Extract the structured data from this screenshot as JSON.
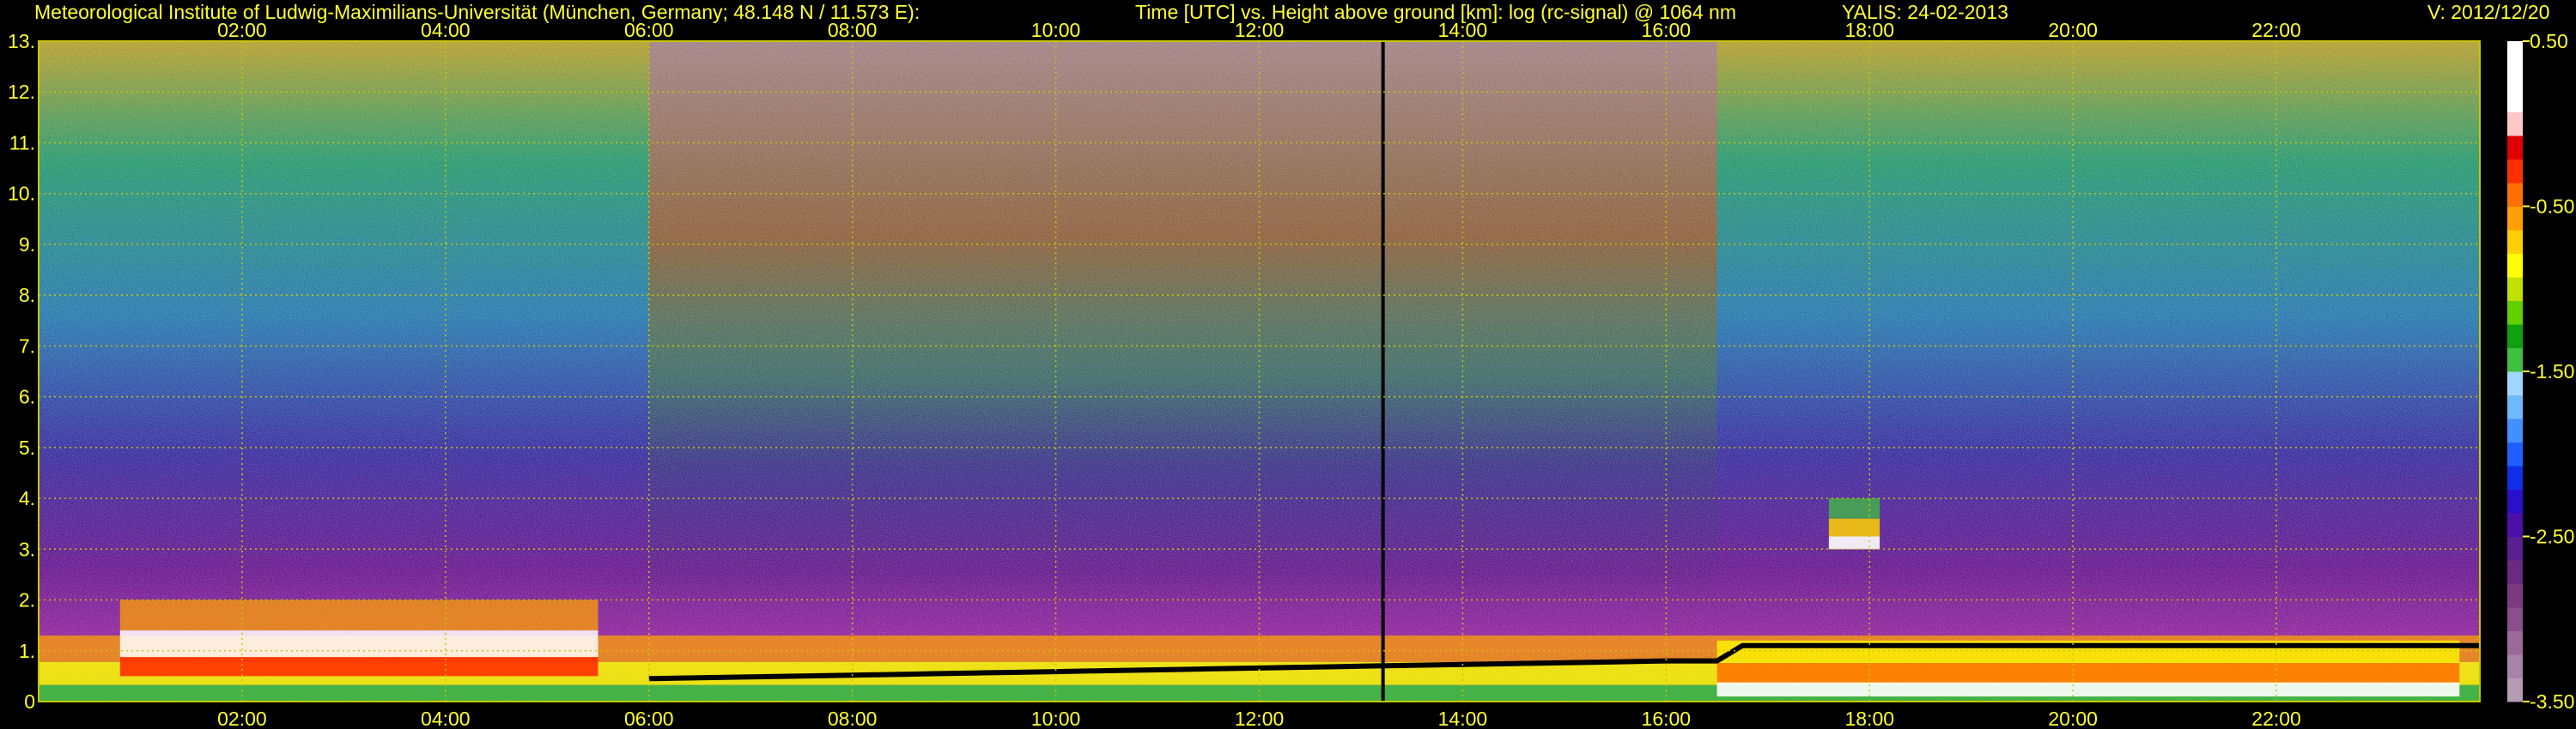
{
  "header": {
    "institute": "Meteorological Institute of Ludwig-Maximilians-Universität (München, Germany; 48.148 N / 11.573 E):",
    "description": "Time [UTC] vs. Height above ground [km]: log (rc-signal) @ 1064 nm",
    "instrument_date": "YALIS: 24-02-2013",
    "version": "V: 2012/12/20"
  },
  "chart_data": {
    "type": "heatmap",
    "title": "Time [UTC] vs. Height above ground [km]: log (rc-signal) @ 1064 nm",
    "x_unit": "hours UTC",
    "xlim": [
      0,
      24
    ],
    "x_ticks": [
      2,
      4,
      6,
      8,
      10,
      12,
      14,
      16,
      18,
      20,
      22
    ],
    "x_tick_labels": [
      "02:00",
      "04:00",
      "06:00",
      "08:00",
      "10:00",
      "12:00",
      "14:00",
      "16:00",
      "18:00",
      "20:00",
      "22:00"
    ],
    "y_unit": "km",
    "ylim": [
      0,
      13
    ],
    "y_ticks": [
      0,
      1,
      2,
      3,
      4,
      5,
      6,
      7,
      8,
      9,
      10,
      11,
      12,
      13
    ],
    "y_tick_labels": [
      "0",
      "1.",
      "2.",
      "3.",
      "4.",
      "5.",
      "6.",
      "7.",
      "8.",
      "9.",
      "10.",
      "11.",
      "12.",
      "13."
    ],
    "grid": true,
    "colorbar": {
      "range": [
        -3.5,
        0.5
      ],
      "ticks": [
        0.5,
        -0.5,
        -1.5,
        -2.5,
        -3.5
      ],
      "tick_labels": [
        "0.50",
        "-0.50",
        "-1.50",
        "-2.50",
        "-3.50"
      ],
      "colors": [
        "#b59cb5",
        "#a883a8",
        "#9a6a9a",
        "#8a4f8a",
        "#7a3a80",
        "#6a2a80",
        "#5a1f90",
        "#4a10a8",
        "#2a10c8",
        "#1030e8",
        "#2060ff",
        "#4090ff",
        "#70b8ff",
        "#a0d8ff",
        "#40c040",
        "#10a010",
        "#60d000",
        "#c0e000",
        "#ffff00",
        "#ffd000",
        "#ffa000",
        "#ff7000",
        "#ff3000",
        "#e00000",
        "#ffc8c8",
        "#ffffff",
        "#ffffff",
        "#ffffff"
      ]
    },
    "features": [
      {
        "name": "boundary layer aerosol",
        "x_range": [
          0,
          24
        ],
        "height_km": [
          0,
          1.3
        ]
      },
      {
        "name": "elevated layer",
        "x_range": [
          0.8,
          5.5
        ],
        "height_km": [
          0.5,
          2.0
        ]
      },
      {
        "name": "cloud base",
        "x_range": [
          16.5,
          23.8
        ],
        "height_km": [
          0.1,
          1.2
        ]
      },
      {
        "name": "isolated cloud",
        "x_range": [
          17.6,
          18.1
        ],
        "height_km": [
          3.0,
          4.0
        ]
      }
    ],
    "background_colors": {
      "night_high": "#2a8a70",
      "day_high": "#9a5a40",
      "mid": "#3a3aa0",
      "low": "#8a2a9a",
      "gridline": "#c8c800",
      "axis_text": "#ffff33"
    }
  }
}
